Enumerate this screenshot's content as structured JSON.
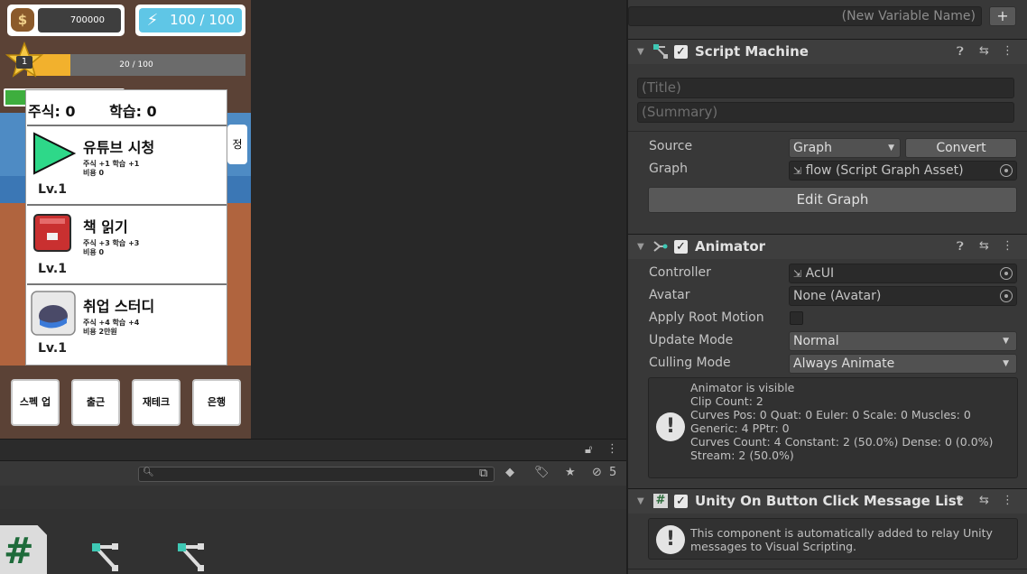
{
  "game": {
    "coins": "700000",
    "energy": "100 / 100",
    "level": "1",
    "xp": "20 / 100",
    "xp_fraction": 0.2,
    "stats": {
      "stock_label": "주식: 0",
      "study_label": "학습: 0"
    },
    "side_button": "정",
    "cards": [
      {
        "title": "유튜브 시청",
        "desc1": "주식 +1 학습 +1",
        "desc2": "비용 0",
        "level": "Lv.1",
        "icon": "play-icon"
      },
      {
        "title": "책 읽기",
        "desc1": "주식 +3 학습 +3",
        "desc2": "비용 0",
        "level": "Lv.1",
        "icon": "book-icon"
      },
      {
        "title": "취업 스터디",
        "desc1": "주식 +4 학습 +4",
        "desc2": "비용 2만원",
        "level": "Lv.1",
        "icon": "study-icon"
      }
    ],
    "bottom_buttons": [
      "스펙 업",
      "출근",
      "재테크",
      "은행"
    ]
  },
  "project": {
    "hidden_count": "5"
  },
  "inspector": {
    "new_variable_placeholder": "(New Variable Name)",
    "add_label": "+",
    "script_machine": {
      "name": "Script Machine",
      "title_placeholder": "(Title)",
      "summary_placeholder": "(Summary)",
      "source_label": "Source",
      "source_value": "Graph",
      "convert_label": "Convert",
      "graph_label": "Graph",
      "graph_value": "flow (Script Graph Asset)",
      "edit_graph_label": "Edit Graph"
    },
    "animator": {
      "name": "Animator",
      "controller_label": "Controller",
      "controller_value": "AcUI",
      "avatar_label": "Avatar",
      "avatar_value": "None (Avatar)",
      "apply_root_motion_label": "Apply Root Motion",
      "update_mode_label": "Update Mode",
      "update_mode_value": "Normal",
      "culling_mode_label": "Culling Mode",
      "culling_mode_value": "Always Animate",
      "info_lines": [
        "Animator is visible",
        "Clip Count: 2",
        "Curves Pos: 0 Quat: 0 Euler: 0 Scale: 0 Muscles: 0",
        "Generic: 4 PPtr: 0",
        "Curves Count: 4 Constant: 2 (50.0%) Dense: 0 (0.0%)",
        "Stream: 2 (50.0%)"
      ]
    },
    "message_list": {
      "name": "Unity On Button Click Message List",
      "info_lines": [
        "This component is automatically added to relay Unity",
        "messages to Visual Scripting."
      ]
    }
  }
}
